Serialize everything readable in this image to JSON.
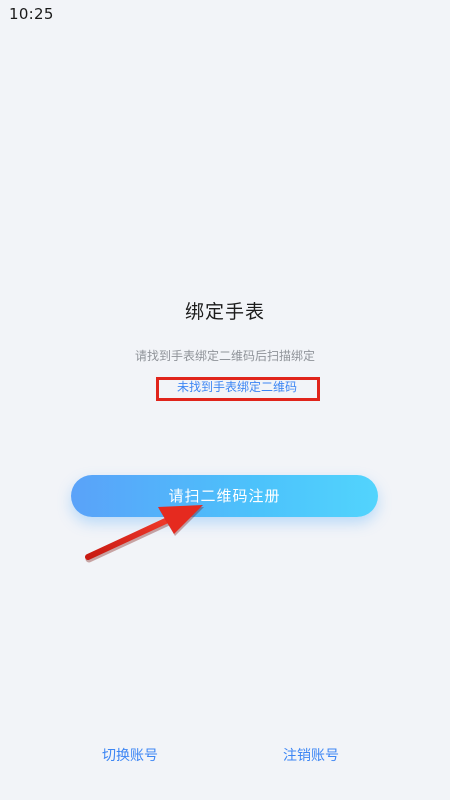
{
  "status_bar": {
    "time": "10:25"
  },
  "main": {
    "title": "绑定手表",
    "subtitle": "请找到手表绑定二维码后扫描绑定",
    "not_found_link": "未找到手表绑定二维码",
    "scan_button_label": "请扫二维码注册"
  },
  "footer": {
    "switch_account": "切换账号",
    "cancel_account": "注销账号"
  },
  "colors": {
    "background": "#f2f4f8",
    "link": "#3d86f4",
    "annotation": "#e0241b",
    "button_gradient_start": "#5aa2f9",
    "button_gradient_end": "#52d4fd"
  }
}
